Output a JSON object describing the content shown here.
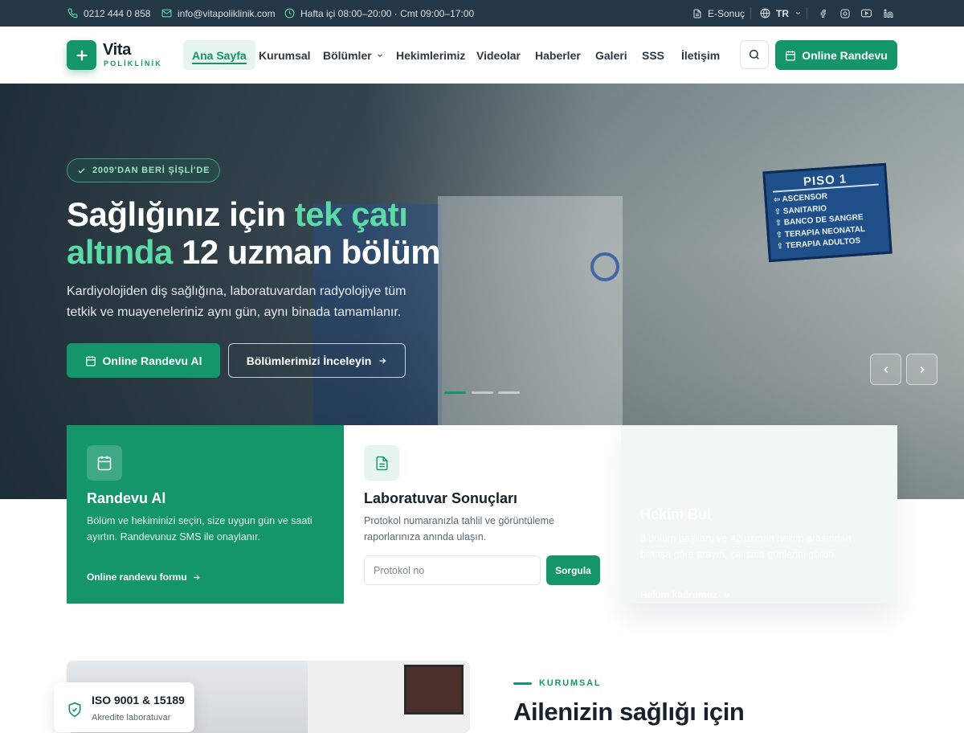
{
  "topbar": {
    "phone": "0212 444 0 858",
    "email": "info@vitapoliklinik.com",
    "hours": "Hafta içi 08:00–20:00 · Cmt 09:00–17:00",
    "e_result": "E-Sonuç",
    "language": "TR",
    "social_icons": [
      "facebook-icon",
      "instagram-icon",
      "youtube-icon",
      "linkedin-icon"
    ]
  },
  "header": {
    "logo_name": "Vita",
    "logo_sub": "POLİKLİNİK",
    "nav": [
      "Ana Sayfa",
      "Kurumsal",
      "Bölümler",
      "Hekimlerimiz",
      "Videolar",
      "Haberler",
      "Galeri",
      "SSS",
      "İletişim"
    ],
    "active_nav": "Ana Sayfa",
    "cta_label": "Online Randevu"
  },
  "hero": {
    "badge": "2009'DAN BERİ ŞİŞLİ'DE",
    "title_part1": "Sağlığınız için ",
    "title_highlight1": "tek çatı",
    "title_highlight2": "altında",
    "title_part2": " 12 uzman bölüm",
    "lead": "Kardiyolojiden diş sağlığına, laboratuvardan radyolojiye tüm tetkik ve muayeneleriniz aynı gün, aynı binada tamamlanır.",
    "primary_button": "Online Randevu Al",
    "secondary_button": "Bölümlerimizi İnceleyin",
    "slides_total": 3,
    "active_slide": 1,
    "sign": {
      "title": "PISO 1",
      "rows": [
        "ASCENSOR",
        "SANITARIO",
        "BANCO DE SANGRE",
        "TERAPIA NEONATAL",
        "TERAPIA ADULTOS"
      ]
    }
  },
  "cards": {
    "appointment": {
      "title": "Randevu Al",
      "text": "Bölüm ve hekiminizi seçin, size uygun gün ve saati ayırtın. Randevunuz SMS ile onaylanır.",
      "link": "Online randevu formu"
    },
    "lab": {
      "title": "Laboratuvar Sonuçları",
      "text": "Protokol numaranızla tahlil ve görüntüleme raporlarınıza anında ulaşın.",
      "input_placeholder": "Protokol no",
      "button": "Sorgula"
    },
    "doctor": {
      "title": "Hekim Bul",
      "text": "8 bölüm başkanı ve 42 uzman hekim arasından branşa göre arayın, çalışma günlerini görün.",
      "link": "Hekim kadromuz"
    }
  },
  "about": {
    "iso_title": "ISO 9001 & 15189",
    "iso_sub": "Akredite laboratuvar",
    "eyebrow": "KURUMSAL",
    "heading": "Ailenizin sağlığı için"
  },
  "colors": {
    "brand": "#14966a",
    "topbar": "#243747",
    "highlight": "#5ddba6"
  }
}
